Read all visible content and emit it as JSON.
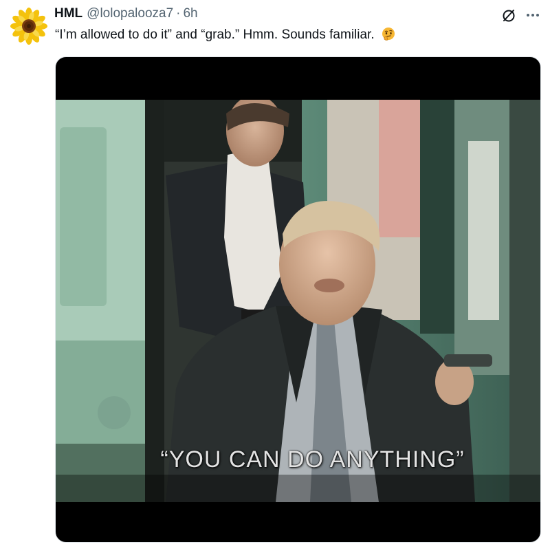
{
  "tweet": {
    "author": {
      "display_name": "HML",
      "handle": "@lolopalooza7",
      "separator": "·",
      "time": "6h",
      "avatar_icon": "sunflower-icon"
    },
    "text": "“I’m allowed to do it” and “grab.” Hmm. Sounds familiar.",
    "emoji": "thinking-face-emoji",
    "actions": {
      "grok_icon": "grok-slash-circle-icon",
      "more_icon": "more-horizontal-icon"
    },
    "media": {
      "type": "video",
      "caption": "“YOU CAN DO ANYTHING”"
    }
  },
  "colors": {
    "text_primary": "#0f1419",
    "text_secondary": "#536471",
    "media_background": "#000000",
    "sunflower_petal": "#f5c518",
    "bus_teal": "#8fb8a3"
  }
}
